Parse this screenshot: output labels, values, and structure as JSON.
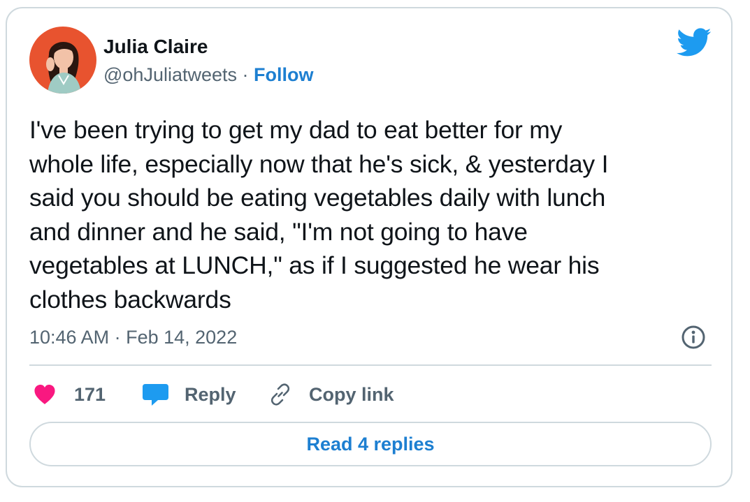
{
  "author": {
    "display_name": "Julia Claire",
    "handle": "@ohJuliatweets",
    "separator": " · ",
    "follow_label": "Follow"
  },
  "tweet": {
    "text": "I've been trying to get my dad to eat better for my\nwhole life, especially now that he's sick, & yesterday I\nsaid you should be eating vegetables daily with lunch\nand dinner and he said, \"I'm not going to have\nvegetables at LUNCH,\" as if I suggested he wear his\nclothes backwards",
    "time": "10:46 AM",
    "separator": " · ",
    "date": "Feb 14, 2022"
  },
  "actions": {
    "like_count": "171",
    "reply_label": "Reply",
    "copy_link_label": "Copy link",
    "read_replies_label": "Read 4 replies"
  },
  "icons": {
    "brand": "twitter-bird-icon",
    "info": "info-icon",
    "like": "heart-icon",
    "reply": "speech-bubble-icon",
    "copy": "link-icon"
  },
  "colors": {
    "brand_blue": "#1d9bf0",
    "link_blue": "#1d7fd1",
    "like_pink": "#f91880",
    "secondary_text": "#536471",
    "border": "#cfd9de",
    "avatar_bg": "#e8532f"
  }
}
